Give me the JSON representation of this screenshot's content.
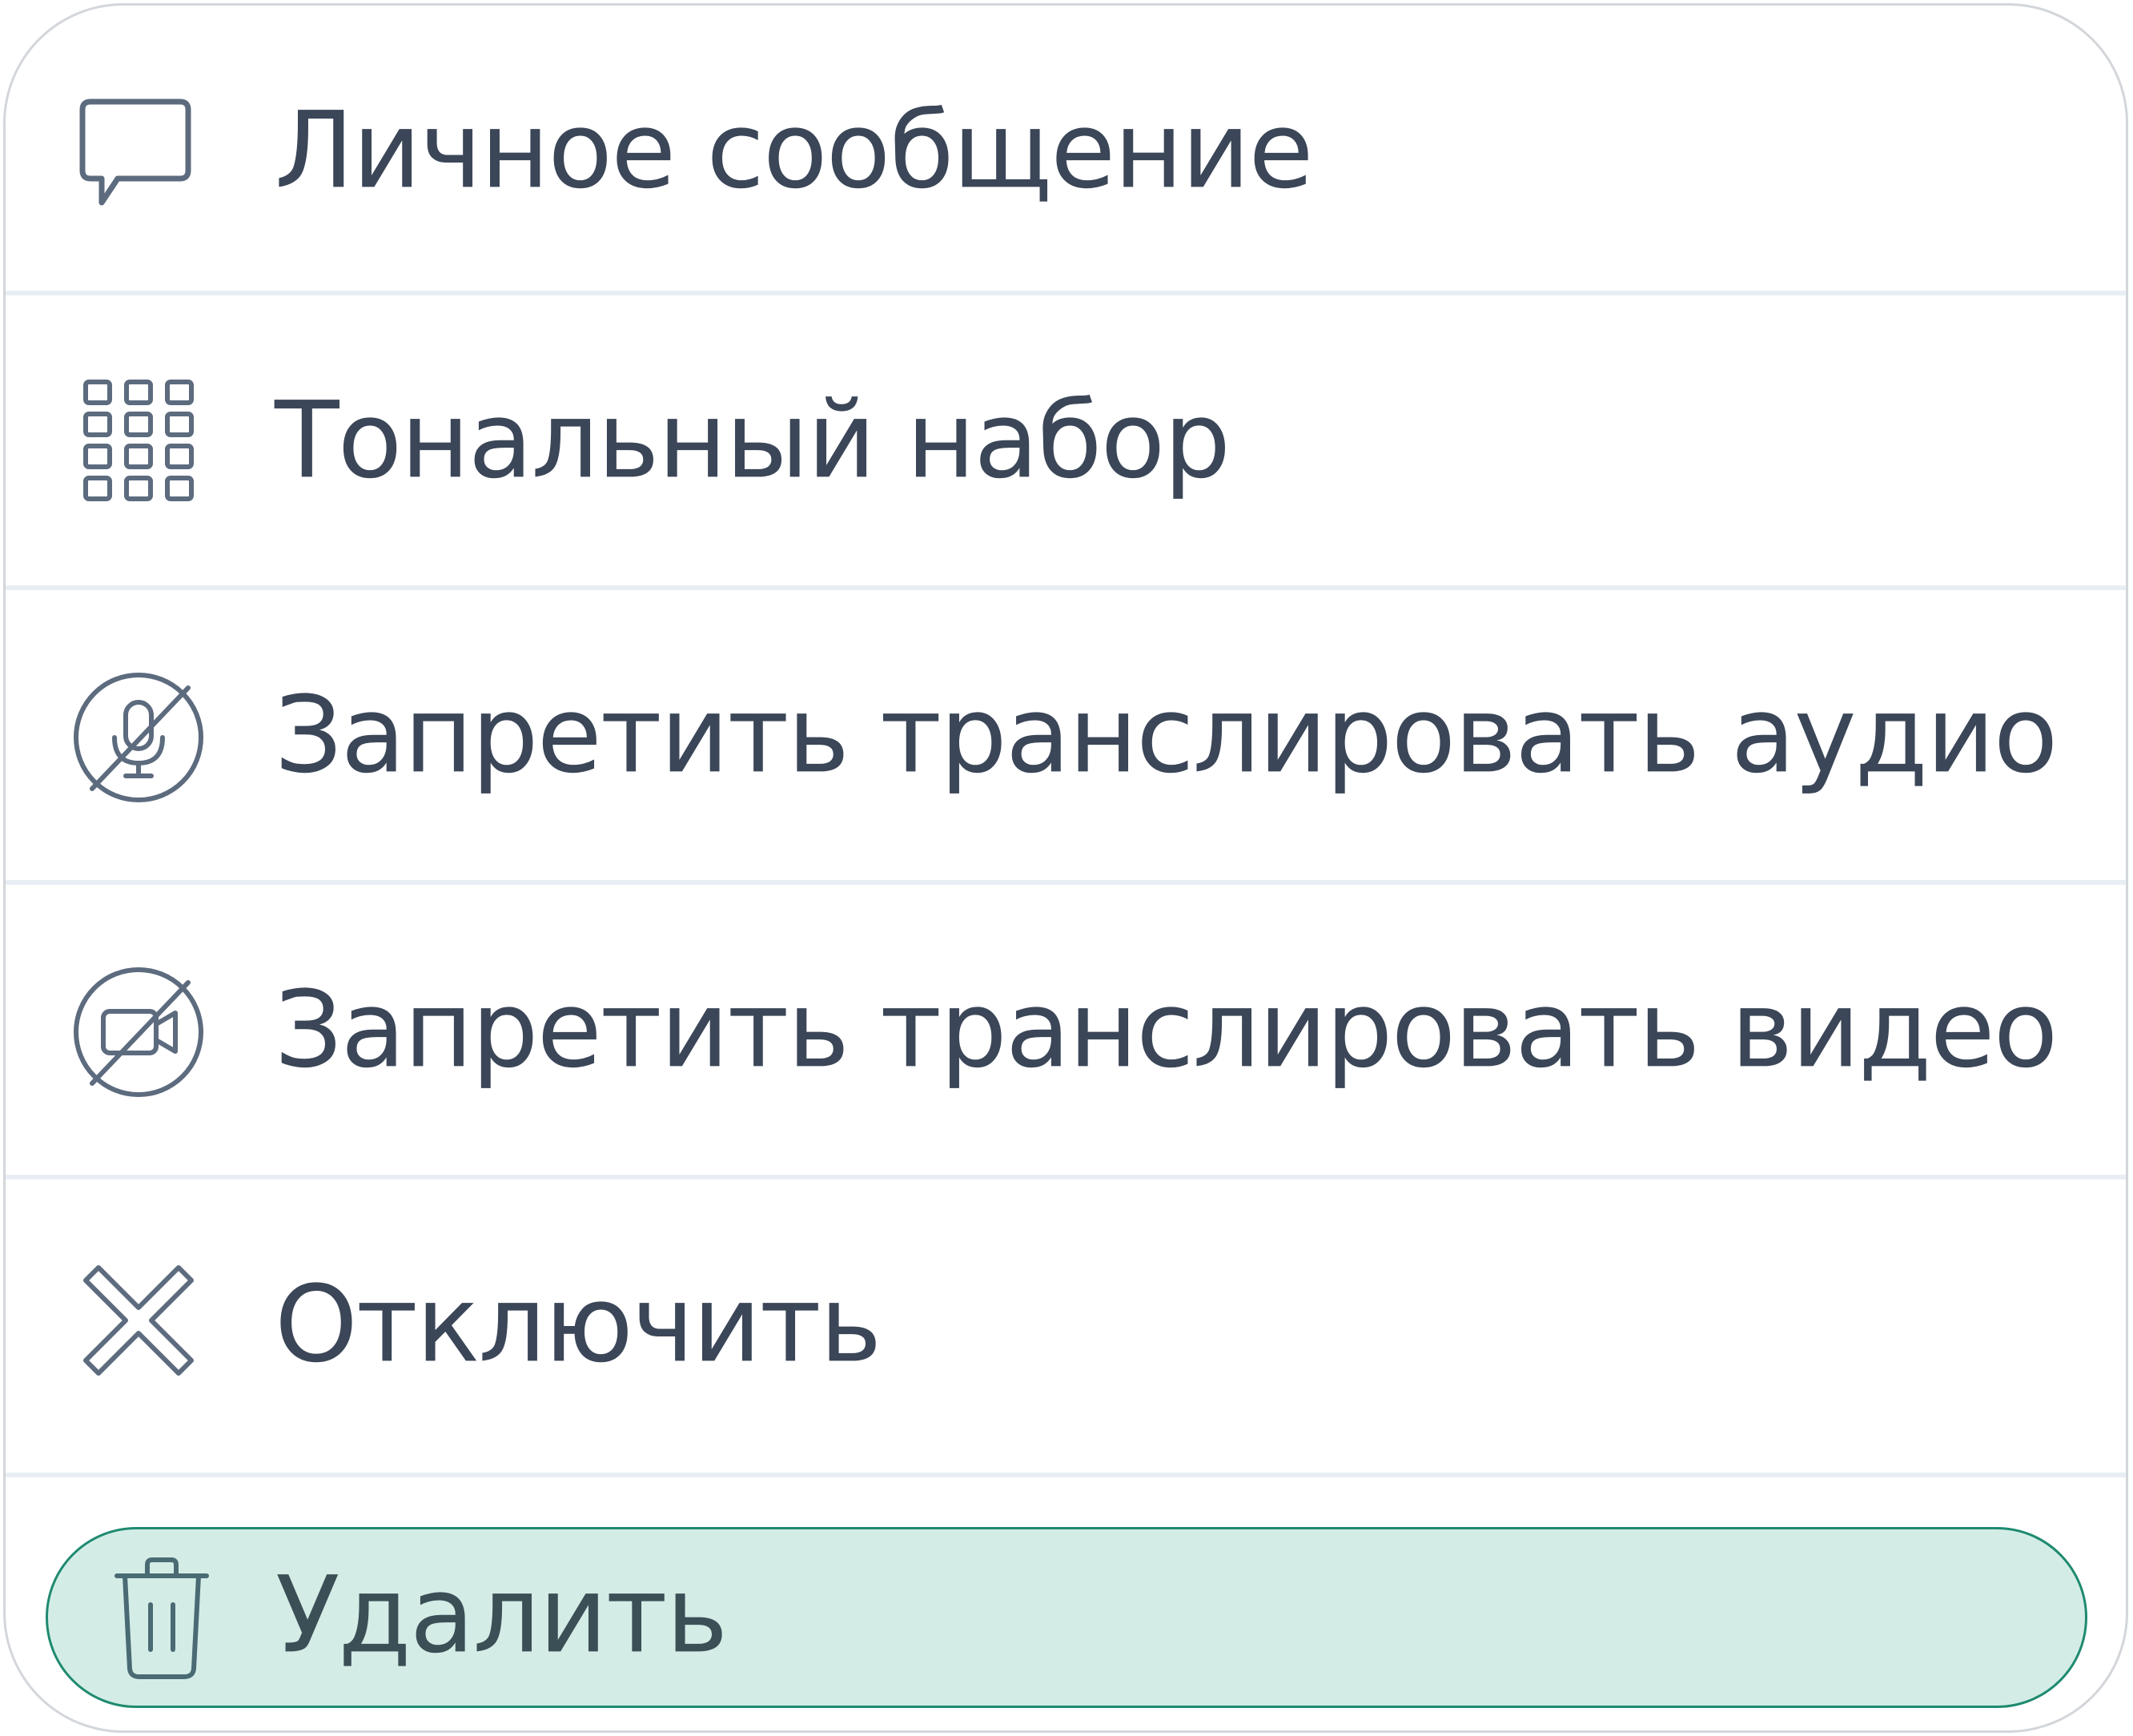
{
  "menu": {
    "items": [
      {
        "label": "Личное сообщение",
        "icon": "chat-bubble-icon"
      },
      {
        "label": "Тональный набор",
        "icon": "dialpad-icon"
      },
      {
        "label": "Запретить транслировать аудио",
        "icon": "mic-off-icon"
      },
      {
        "label": "Запретить транслировать видео",
        "icon": "camera-off-icon"
      },
      {
        "label": "Отключить",
        "icon": "close-icon"
      },
      {
        "label": "Удалить",
        "icon": "trash-icon",
        "highlighted": true
      }
    ]
  },
  "colors": {
    "text": "#3b4658",
    "icon": "#5d6b7e",
    "divider": "#e9eef5",
    "highlight_bg": "#d3ede6",
    "highlight_border": "#1f8a70"
  }
}
